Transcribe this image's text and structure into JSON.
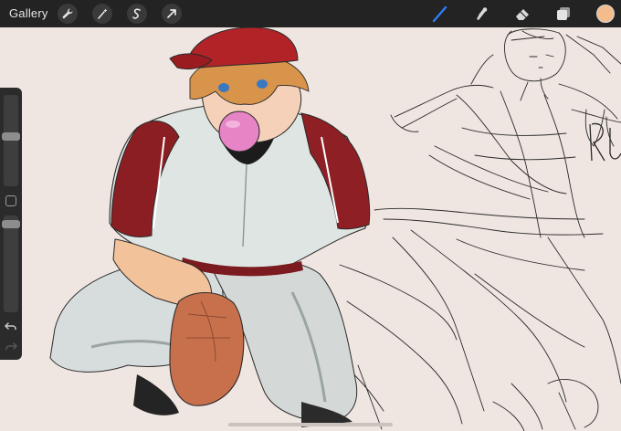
{
  "toolbar": {
    "gallery_label": "Gallery",
    "left_tools": [
      "wrench-icon",
      "magic-wand-icon",
      "selection-icon",
      "transform-arrow-icon"
    ],
    "right_tools": [
      "brush-icon",
      "smudge-icon",
      "eraser-icon",
      "layers-icon"
    ],
    "accent_color": "#2f7bf6",
    "current_color": "#f3bc8c"
  },
  "sidebar": {
    "brush_size_level": 0.55,
    "opacity_level": 0.95,
    "controls": [
      "brush-size-slider",
      "modify-button",
      "opacity-slider",
      "undo-icon",
      "redo-icon"
    ]
  },
  "canvas": {
    "background": "#efe6e1"
  }
}
